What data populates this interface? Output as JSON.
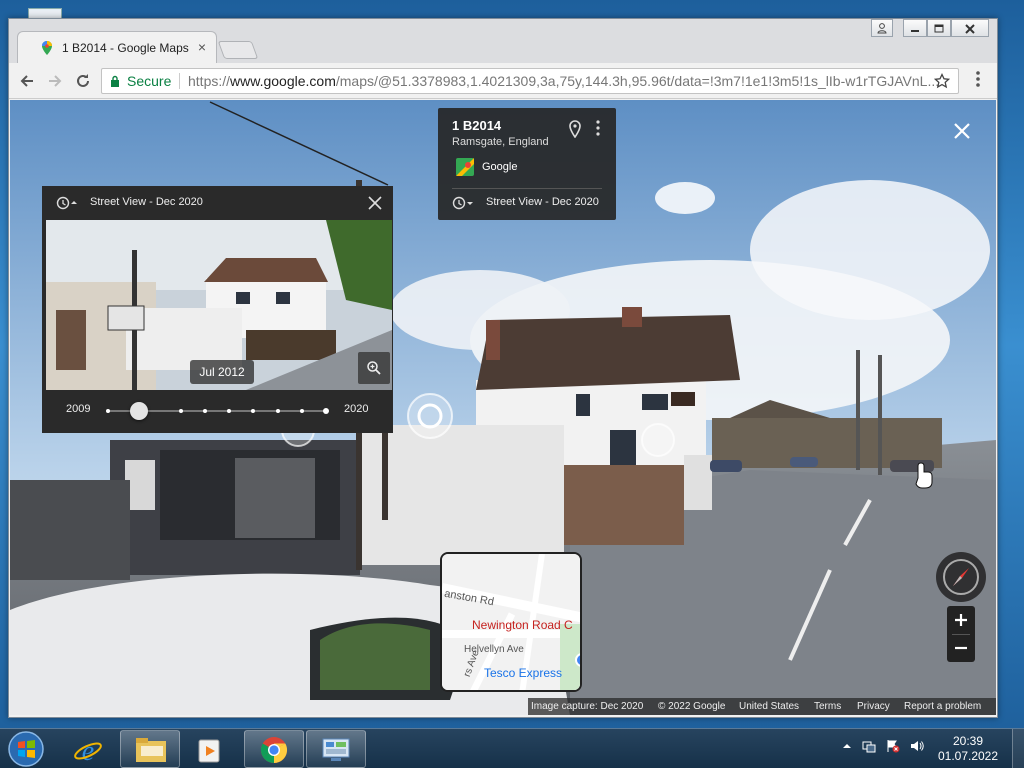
{
  "browser": {
    "tab_title": "1 B2014 - Google Maps",
    "tab_close": "×",
    "security_label": "Secure",
    "url_prefix": "https://",
    "url_host": "www.google.com",
    "url_path": "/maps/@51.3378983,1.4021309,3a,75y,144.3h,95.96t/data=!3m7!1e1!3m5!1s_lIb-w1rTGJAVnL..."
  },
  "place_card": {
    "title": "1 B2014",
    "subtitle": "Ramsgate, England",
    "source": "Google",
    "timeline_label": "Street View - Dec 2020"
  },
  "history_panel": {
    "header": "Street View - Dec 2020",
    "selected_date": "Jul 2012",
    "start_year": "2009",
    "end_year": "2020",
    "selected_fraction": 0.14
  },
  "minimap": {
    "road_1": "anston Rd",
    "road_2": "Newington Road C",
    "road_3": "Helvellyn Ave",
    "poi": "Tesco Express",
    "road_4": "rs Ave"
  },
  "footer": {
    "capture": "Image capture: Dec 2020",
    "copyright": "© 2022 Google",
    "region": "United States",
    "terms": "Terms",
    "privacy": "Privacy",
    "report": "Report a problem"
  },
  "clock": {
    "time": "20:39",
    "date": "01.07.2022"
  },
  "icons": [
    "maps-favicon-icon",
    "back-icon",
    "forward-icon",
    "reload-icon",
    "lock-icon",
    "star-icon",
    "menu-icon",
    "pin-icon",
    "history-icon",
    "close-icon",
    "magnify-icon",
    "compass-icon",
    "zoom-in-icon",
    "zoom-out-icon",
    "start-orb-icon",
    "ie-icon",
    "explorer-icon",
    "media-player-icon",
    "chrome-icon",
    "control-panel-icon"
  ]
}
